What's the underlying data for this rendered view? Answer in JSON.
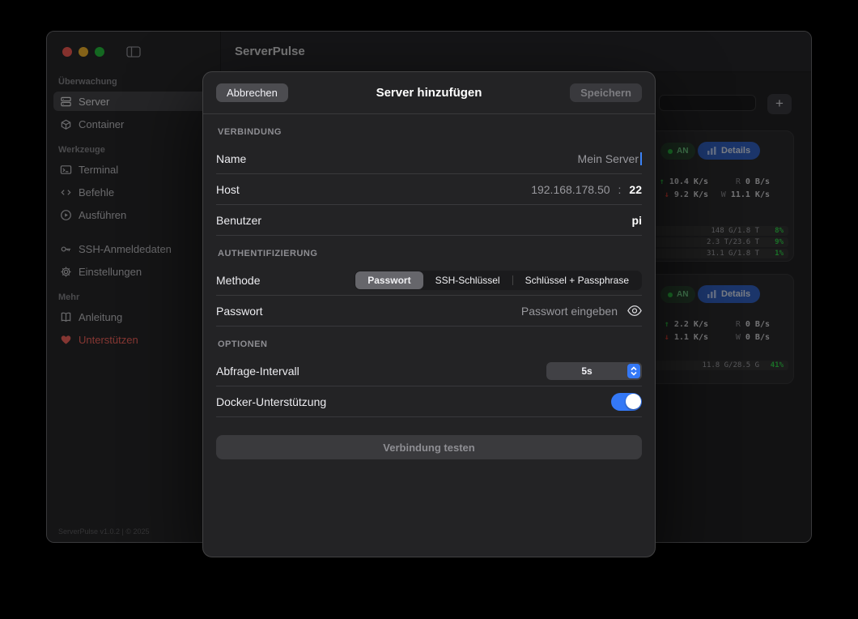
{
  "window": {
    "title": "ServerPulse",
    "footer": "ServerPulse v1.0.2 | © 2025"
  },
  "sidebar": {
    "sections": [
      {
        "header": "Überwachung",
        "items": [
          {
            "label": "Server"
          },
          {
            "label": "Container"
          }
        ]
      },
      {
        "header": "Werkzeuge",
        "items": [
          {
            "label": "Terminal"
          },
          {
            "label": "Befehle"
          },
          {
            "label": "Ausführen"
          }
        ]
      },
      {
        "header": "",
        "items": [
          {
            "label": "SSH-Anmeldedaten"
          },
          {
            "label": "Einstellungen"
          }
        ]
      },
      {
        "header": "Mehr",
        "items": [
          {
            "label": "Anleitung"
          },
          {
            "label": "Unterstützen"
          }
        ]
      }
    ]
  },
  "toolbar": {
    "search_value": "",
    "add_button": "+"
  },
  "cards": [
    {
      "status": "AN",
      "details_label": "Details",
      "net": {
        "up_arrow": "↑",
        "up_value": "10.4 K/s",
        "read_label": "R",
        "read_value": "0 B/s",
        "down_arrow": "↓",
        "down_value": "9.2 K/s",
        "write_label": "W",
        "write_value": "11.1 K/s"
      },
      "disks": [
        {
          "usage": "148 G/1.8 T",
          "percent": "8%"
        },
        {
          "usage": "2.3 T/23.6 T",
          "percent": "9%"
        },
        {
          "usage": "31.1 G/1.8 T",
          "percent": "1%"
        }
      ]
    },
    {
      "status": "AN",
      "details_label": "Details",
      "net": {
        "up_arrow": "↑",
        "up_value": "2.2 K/s",
        "read_label": "R",
        "read_value": "0 B/s",
        "down_arrow": "↓",
        "down_value": "1.1 K/s",
        "write_label": "W",
        "write_value": "0 B/s"
      },
      "disks": [
        {
          "usage": "11.8 G/28.5 G",
          "percent": "41%"
        }
      ]
    }
  ],
  "modal": {
    "cancel_label": "Abbrechen",
    "title": "Server hinzufügen",
    "save_label": "Speichern",
    "sections": {
      "connection": "VERBINDUNG",
      "auth": "AUTHENTIFIZIERUNG",
      "options": "OPTIONEN"
    },
    "fields": {
      "name": {
        "label": "Name",
        "value": "Mein Server"
      },
      "host": {
        "label": "Host",
        "value": "192.168.178.50",
        "separator": ":",
        "port": "22"
      },
      "user": {
        "label": "Benutzer",
        "value": "pi"
      },
      "method": {
        "label": "Methode",
        "options": [
          "Passwort",
          "SSH-Schlüssel",
          "Schlüssel + Passphrase"
        ],
        "selected": "Passwort"
      },
      "password": {
        "label": "Passwort",
        "placeholder": "Passwort eingeben"
      },
      "interval": {
        "label": "Abfrage-Intervall",
        "value": "5s"
      },
      "docker": {
        "label": "Docker-Unterstützung",
        "enabled": true
      }
    },
    "test_button": "Verbindung testen"
  },
  "colors": {
    "accent_blue": "#3478f6",
    "green": "#32d74b",
    "red": "#ff453a"
  }
}
